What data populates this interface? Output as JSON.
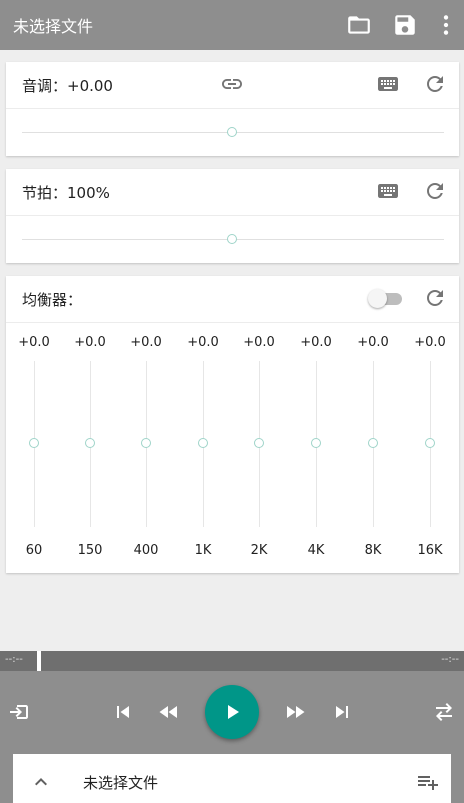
{
  "app": {
    "title": "未选择文件"
  },
  "icons": {
    "open_folder": "folder-icon",
    "save": "save-icon",
    "more": "more-vert-icon",
    "link": "link-icon",
    "keyboard": "keyboard-icon",
    "reset": "refresh-icon"
  },
  "pitch": {
    "label": "音调：+0.00",
    "slider_fraction": 0.5
  },
  "tempo": {
    "label": "节拍：100%",
    "slider_fraction": 0.5
  },
  "equalizer": {
    "label": "均衡器：",
    "enabled": false,
    "bands": [
      {
        "gain": "+0.0",
        "freq": "60"
      },
      {
        "gain": "+0.0",
        "freq": "150"
      },
      {
        "gain": "+0.0",
        "freq": "400"
      },
      {
        "gain": "+0.0",
        "freq": "1K"
      },
      {
        "gain": "+0.0",
        "freq": "2K"
      },
      {
        "gain": "+0.0",
        "freq": "4K"
      },
      {
        "gain": "+0.0",
        "freq": "8K"
      },
      {
        "gain": "+0.0",
        "freq": "16K"
      }
    ]
  },
  "player": {
    "time_elapsed": "--:--",
    "time_total": "--:--",
    "progress_fraction": 0.0,
    "current_file": "未选择文件"
  },
  "colors": {
    "appbar": "#8e8e8e",
    "accent": "#009688",
    "thumb": "#9fd4c9"
  }
}
